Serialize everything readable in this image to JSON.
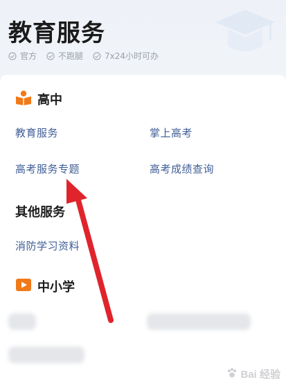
{
  "header": {
    "title": "教育服务",
    "tags": [
      {
        "label": "官方",
        "icon": "check-circle-icon"
      },
      {
        "label": "不跑腿",
        "icon": "check-circle-icon"
      },
      {
        "label": "7x24小时可办",
        "icon": "check-circle-icon"
      }
    ],
    "decoration_icon": "graduation-cap-icon"
  },
  "sections": {
    "high_school": {
      "title": "高中",
      "icon": "book-person-icon",
      "icon_color": "#f07a1a",
      "links": [
        "教育服务",
        "掌上高考",
        "高考服务专题",
        "高考成绩查询"
      ]
    },
    "other_services": {
      "title": "其他服务",
      "links": [
        "消防学习资料"
      ]
    },
    "primary_middle": {
      "title": "中小学",
      "icon": "play-folder-icon",
      "icon_color": "#f07a1a"
    }
  },
  "colors": {
    "link": "#3f5d96",
    "accent": "#f07a1a",
    "annotation_arrow": "#e0242c"
  },
  "watermark": {
    "text": "Bai 经验",
    "icon": "paw-icon"
  }
}
